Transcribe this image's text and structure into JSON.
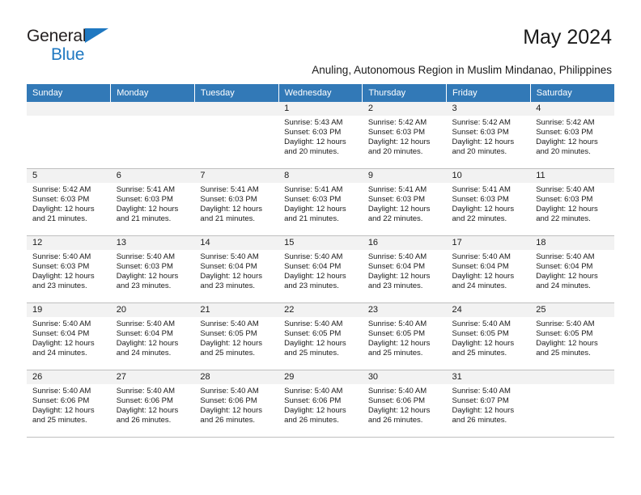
{
  "brand": {
    "name_line1": "General",
    "name_line2": "Blue",
    "accent_color": "#1f78c1"
  },
  "header": {
    "month_title": "May 2024",
    "location_subtitle": "Anuling, Autonomous Region in Muslim Mindanao, Philippines"
  },
  "calendar": {
    "header_bg": "#3279b7",
    "weekday_headers": [
      "Sunday",
      "Monday",
      "Tuesday",
      "Wednesday",
      "Thursday",
      "Friday",
      "Saturday"
    ],
    "weeks": [
      [
        {
          "day": ""
        },
        {
          "day": ""
        },
        {
          "day": ""
        },
        {
          "day": "1",
          "sunrise": "Sunrise: 5:43 AM",
          "sunset": "Sunset: 6:03 PM",
          "daylight": "Daylight: 12 hours and 20 minutes."
        },
        {
          "day": "2",
          "sunrise": "Sunrise: 5:42 AM",
          "sunset": "Sunset: 6:03 PM",
          "daylight": "Daylight: 12 hours and 20 minutes."
        },
        {
          "day": "3",
          "sunrise": "Sunrise: 5:42 AM",
          "sunset": "Sunset: 6:03 PM",
          "daylight": "Daylight: 12 hours and 20 minutes."
        },
        {
          "day": "4",
          "sunrise": "Sunrise: 5:42 AM",
          "sunset": "Sunset: 6:03 PM",
          "daylight": "Daylight: 12 hours and 20 minutes."
        }
      ],
      [
        {
          "day": "5",
          "sunrise": "Sunrise: 5:42 AM",
          "sunset": "Sunset: 6:03 PM",
          "daylight": "Daylight: 12 hours and 21 minutes."
        },
        {
          "day": "6",
          "sunrise": "Sunrise: 5:41 AM",
          "sunset": "Sunset: 6:03 PM",
          "daylight": "Daylight: 12 hours and 21 minutes."
        },
        {
          "day": "7",
          "sunrise": "Sunrise: 5:41 AM",
          "sunset": "Sunset: 6:03 PM",
          "daylight": "Daylight: 12 hours and 21 minutes."
        },
        {
          "day": "8",
          "sunrise": "Sunrise: 5:41 AM",
          "sunset": "Sunset: 6:03 PM",
          "daylight": "Daylight: 12 hours and 21 minutes."
        },
        {
          "day": "9",
          "sunrise": "Sunrise: 5:41 AM",
          "sunset": "Sunset: 6:03 PM",
          "daylight": "Daylight: 12 hours and 22 minutes."
        },
        {
          "day": "10",
          "sunrise": "Sunrise: 5:41 AM",
          "sunset": "Sunset: 6:03 PM",
          "daylight": "Daylight: 12 hours and 22 minutes."
        },
        {
          "day": "11",
          "sunrise": "Sunrise: 5:40 AM",
          "sunset": "Sunset: 6:03 PM",
          "daylight": "Daylight: 12 hours and 22 minutes."
        }
      ],
      [
        {
          "day": "12",
          "sunrise": "Sunrise: 5:40 AM",
          "sunset": "Sunset: 6:03 PM",
          "daylight": "Daylight: 12 hours and 23 minutes."
        },
        {
          "day": "13",
          "sunrise": "Sunrise: 5:40 AM",
          "sunset": "Sunset: 6:03 PM",
          "daylight": "Daylight: 12 hours and 23 minutes."
        },
        {
          "day": "14",
          "sunrise": "Sunrise: 5:40 AM",
          "sunset": "Sunset: 6:04 PM",
          "daylight": "Daylight: 12 hours and 23 minutes."
        },
        {
          "day": "15",
          "sunrise": "Sunrise: 5:40 AM",
          "sunset": "Sunset: 6:04 PM",
          "daylight": "Daylight: 12 hours and 23 minutes."
        },
        {
          "day": "16",
          "sunrise": "Sunrise: 5:40 AM",
          "sunset": "Sunset: 6:04 PM",
          "daylight": "Daylight: 12 hours and 23 minutes."
        },
        {
          "day": "17",
          "sunrise": "Sunrise: 5:40 AM",
          "sunset": "Sunset: 6:04 PM",
          "daylight": "Daylight: 12 hours and 24 minutes."
        },
        {
          "day": "18",
          "sunrise": "Sunrise: 5:40 AM",
          "sunset": "Sunset: 6:04 PM",
          "daylight": "Daylight: 12 hours and 24 minutes."
        }
      ],
      [
        {
          "day": "19",
          "sunrise": "Sunrise: 5:40 AM",
          "sunset": "Sunset: 6:04 PM",
          "daylight": "Daylight: 12 hours and 24 minutes."
        },
        {
          "day": "20",
          "sunrise": "Sunrise: 5:40 AM",
          "sunset": "Sunset: 6:04 PM",
          "daylight": "Daylight: 12 hours and 24 minutes."
        },
        {
          "day": "21",
          "sunrise": "Sunrise: 5:40 AM",
          "sunset": "Sunset: 6:05 PM",
          "daylight": "Daylight: 12 hours and 25 minutes."
        },
        {
          "day": "22",
          "sunrise": "Sunrise: 5:40 AM",
          "sunset": "Sunset: 6:05 PM",
          "daylight": "Daylight: 12 hours and 25 minutes."
        },
        {
          "day": "23",
          "sunrise": "Sunrise: 5:40 AM",
          "sunset": "Sunset: 6:05 PM",
          "daylight": "Daylight: 12 hours and 25 minutes."
        },
        {
          "day": "24",
          "sunrise": "Sunrise: 5:40 AM",
          "sunset": "Sunset: 6:05 PM",
          "daylight": "Daylight: 12 hours and 25 minutes."
        },
        {
          "day": "25",
          "sunrise": "Sunrise: 5:40 AM",
          "sunset": "Sunset: 6:05 PM",
          "daylight": "Daylight: 12 hours and 25 minutes."
        }
      ],
      [
        {
          "day": "26",
          "sunrise": "Sunrise: 5:40 AM",
          "sunset": "Sunset: 6:06 PM",
          "daylight": "Daylight: 12 hours and 25 minutes."
        },
        {
          "day": "27",
          "sunrise": "Sunrise: 5:40 AM",
          "sunset": "Sunset: 6:06 PM",
          "daylight": "Daylight: 12 hours and 26 minutes."
        },
        {
          "day": "28",
          "sunrise": "Sunrise: 5:40 AM",
          "sunset": "Sunset: 6:06 PM",
          "daylight": "Daylight: 12 hours and 26 minutes."
        },
        {
          "day": "29",
          "sunrise": "Sunrise: 5:40 AM",
          "sunset": "Sunset: 6:06 PM",
          "daylight": "Daylight: 12 hours and 26 minutes."
        },
        {
          "day": "30",
          "sunrise": "Sunrise: 5:40 AM",
          "sunset": "Sunset: 6:06 PM",
          "daylight": "Daylight: 12 hours and 26 minutes."
        },
        {
          "day": "31",
          "sunrise": "Sunrise: 5:40 AM",
          "sunset": "Sunset: 6:07 PM",
          "daylight": "Daylight: 12 hours and 26 minutes."
        },
        {
          "day": ""
        }
      ]
    ]
  }
}
